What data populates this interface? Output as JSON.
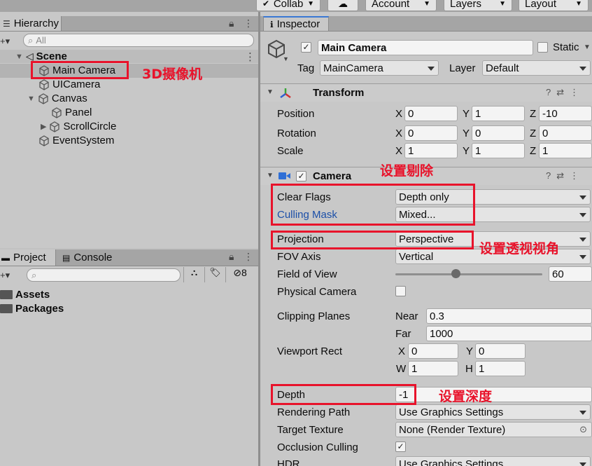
{
  "toolbar": {
    "collab": "Collab",
    "account": "Account",
    "layers": "Layers",
    "layout": "Layout"
  },
  "hierarchy": {
    "tab": "Hierarchy",
    "search_placeholder": "All",
    "scene": "Scene",
    "items": [
      "Main Camera",
      "UICamera",
      "Canvas",
      "Panel",
      "ScrollCircle",
      "EventSystem"
    ]
  },
  "project": {
    "tab_project": "Project",
    "tab_console": "Console",
    "hidden_count": "8",
    "folders": [
      "Assets",
      "Packages"
    ]
  },
  "inspector": {
    "tab": "Inspector",
    "object_name": "Main Camera",
    "static_label": "Static",
    "tag_label": "Tag",
    "tag_value": "MainCamera",
    "layer_label": "Layer",
    "layer_value": "Default",
    "transform": {
      "title": "Transform",
      "position_label": "Position",
      "rotation_label": "Rotation",
      "scale_label": "Scale",
      "axis_x": "X",
      "axis_y": "Y",
      "axis_z": "Z",
      "position": [
        "0",
        "1",
        "-10"
      ],
      "rotation": [
        "0",
        "0",
        "0"
      ],
      "scale": [
        "1",
        "1",
        "1"
      ]
    },
    "camera": {
      "title": "Camera",
      "clear_flags_label": "Clear Flags",
      "clear_flags_value": "Depth only",
      "culling_mask_label": "Culling Mask",
      "culling_mask_value": "Mixed...",
      "projection_label": "Projection",
      "projection_value": "Perspective",
      "fov_axis_label": "FOV Axis",
      "fov_axis_value": "Vertical",
      "fov_label": "Field of View",
      "fov_value": "60",
      "fov_slider_fraction": 0.41,
      "physical_label": "Physical Camera",
      "clipping_label": "Clipping Planes",
      "near_label": "Near",
      "near_value": "0.3",
      "far_label": "Far",
      "far_value": "1000",
      "viewport_label": "Viewport Rect",
      "vp_x_label": "X",
      "vp_x": "0",
      "vp_y_label": "Y",
      "vp_y": "0",
      "vp_w_label": "W",
      "vp_w": "1",
      "vp_h_label": "H",
      "vp_h": "1",
      "depth_label": "Depth",
      "depth_value": "-1",
      "rendering_path_label": "Rendering Path",
      "rendering_path_value": "Use Graphics Settings",
      "target_texture_label": "Target Texture",
      "target_texture_value": "None (Render Texture)",
      "occlusion_label": "Occlusion Culling",
      "hdr_label": "HDR",
      "hdr_value": "Use Graphics Settings"
    }
  },
  "annotations": {
    "camera3d": "3D摄像机",
    "culling": "设置剔除",
    "perspective": "设置透视视角",
    "depth": "设置深度"
  },
  "colors": {
    "highlight_red": "#e8132b",
    "panel_bg": "#c8c8c8",
    "link_blue": "#1b4fa8"
  }
}
